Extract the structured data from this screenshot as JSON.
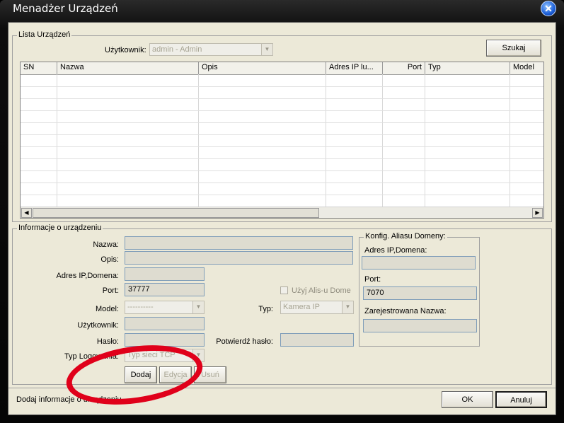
{
  "window": {
    "title": "Menadżer Urządzeń",
    "close_label": "✕"
  },
  "device_list": {
    "legend": "Lista Urządzeń",
    "user_label": "Użytkownik:",
    "user_value": "admin - Admin",
    "search_button": "Szukaj",
    "columns": [
      "SN",
      "Nazwa",
      "Opis",
      "Adres IP lu...",
      "Port",
      "Typ",
      "Model"
    ],
    "rows": []
  },
  "device_info": {
    "legend": "Informacje o urządzeniu",
    "name_label": "Nazwa:",
    "name_value": "",
    "desc_label": "Opis:",
    "desc_value": "",
    "ip_label": "Adres IP,Domena:",
    "ip_value": "",
    "port_label": "Port:",
    "port_value": "37777",
    "model_label": "Model:",
    "model_value": "----------",
    "user_label": "Użytkownik:",
    "user_value": "",
    "pass_label": "Hasło:",
    "pass_value": "",
    "login_type_label": "Typ Logowania:",
    "login_type_value": "Typ sieci TCP",
    "use_alias_label": "Użyj Alis-u Dome",
    "type_label": "Typ:",
    "type_value": "Kamera IP",
    "confirm_pass_label": "Potwierdź hasło:",
    "confirm_pass_value": "",
    "add_button": "Dodaj",
    "edit_button": "Edycja",
    "delete_button": "Usuń"
  },
  "alias_config": {
    "legend": "Konfig. Aliasu Domeny:",
    "ip_label": "Adres IP,Domena:",
    "ip_value": "",
    "port_label": "Port:",
    "port_value": "7070",
    "reg_name_label": "Zarejestrowana Nazwa:",
    "reg_name_value": ""
  },
  "footer": {
    "status": "Dodaj informacje o urządzeniu",
    "ok_button": "OK",
    "cancel_button": "Anuluj"
  },
  "colors": {
    "annotation_circle": "#e0001a",
    "title_bar": "#000000",
    "dialog_bg": "#ece9d8"
  }
}
